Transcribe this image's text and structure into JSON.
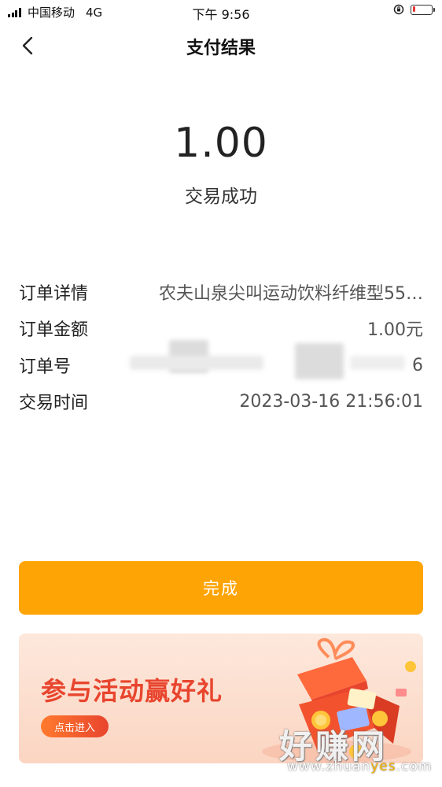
{
  "status_bar": {
    "carrier": "中国移动",
    "network": "4G",
    "time": "下午 9:56",
    "battery_level": 0.15
  },
  "nav": {
    "title": "支付结果"
  },
  "result": {
    "amount": "1.00",
    "status": "交易成功"
  },
  "details": [
    {
      "label": "订单详情",
      "value": "农夫山泉尖叫运动饮料纤维型55…"
    },
    {
      "label": "订单金额",
      "value": "1.00元"
    },
    {
      "label": "订单号",
      "value": "6"
    },
    {
      "label": "交易时间",
      "value": "2023-03-16 21:56:01"
    }
  ],
  "done_button": {
    "label": "完成"
  },
  "banner": {
    "title": "参与活动赢好礼",
    "enter_label": "点击进入"
  },
  "watermark": {
    "text": "好赚网",
    "url_prefix": "www.zhuan",
    "url_mid": "yes",
    "url_suffix": ".com"
  },
  "colors": {
    "accent": "#ffa405",
    "promo_red": "#e8452e"
  }
}
